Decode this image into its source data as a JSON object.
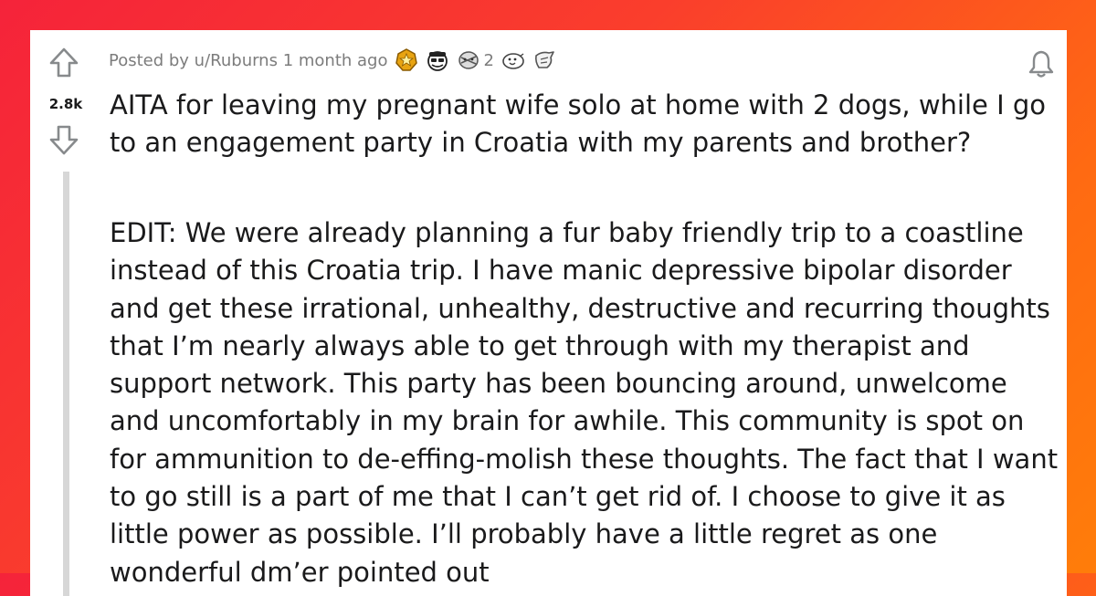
{
  "post": {
    "score": "2.8k",
    "meta": {
      "posted_by": "Posted by u/Ruburns 1 month ago",
      "awards": [
        {
          "icon": "gold-medal-icon"
        },
        {
          "icon": "wearing-is-caring-icon"
        },
        {
          "icon": "hugz-icon",
          "count": "2"
        },
        {
          "icon": "wholesome-seal-icon"
        },
        {
          "icon": "hug-hands-icon"
        }
      ]
    },
    "title": "AITA for leaving my pregnant wife solo at home with 2 dogs, while I go to an engagement party in Croatia with my parents and brother?",
    "body": "EDIT: We were already planning a fur baby friendly trip to a coastline instead of this Croatia trip. I have manic depressive bipolar disorder and get these irrational, unhealthy, destructive and recurring thoughts that I’m nearly always able to get through with my therapist and support network. This party has been bouncing around, unwelcome and uncomfortably in my brain for awhile. This community is spot on for ammunition to de-effing-molish these thoughts. The fact that I want to go still is a part of me that I can’t get rid of. I choose to give it as little power as possible. I’ll probably have a little regret as one wonderful dm’er pointed out"
  },
  "icons": {
    "upvote": "arrow-up-icon",
    "downvote": "arrow-down-icon",
    "notify": "bell-icon"
  },
  "colors": {
    "background_gradient": [
      "#f5233a",
      "#ff7d0a"
    ],
    "card": "#ffffff",
    "text": "#1a1a1b",
    "meta_text": "#7c7c7c",
    "thread_line": "#d7d7d7"
  }
}
